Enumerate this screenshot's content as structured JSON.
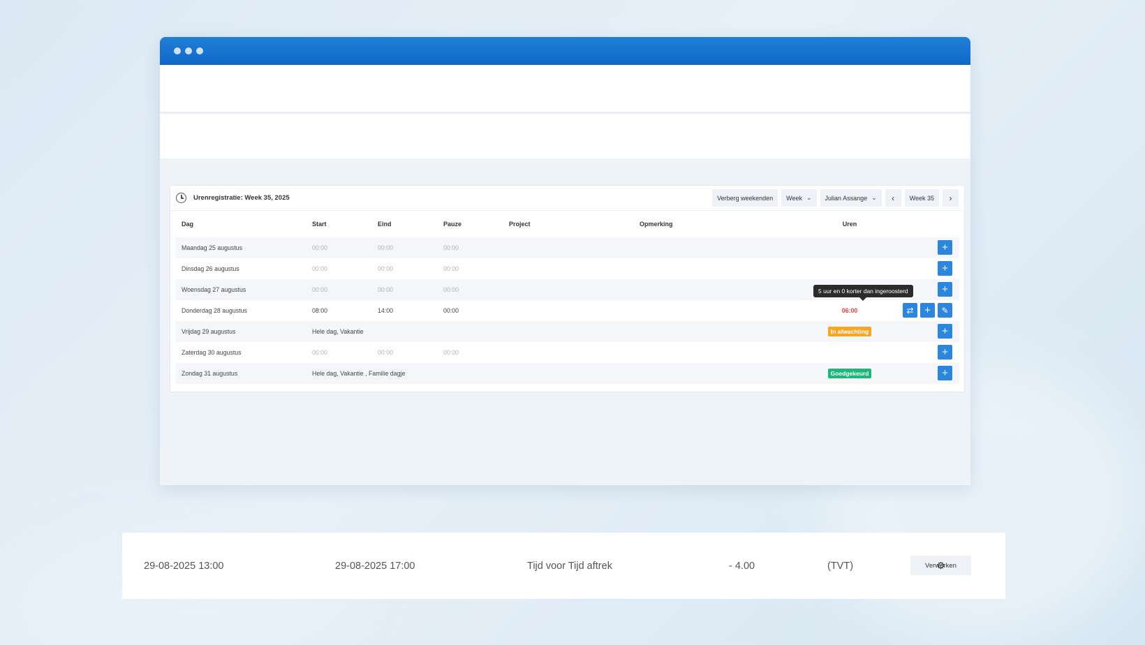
{
  "card": {
    "title": "Urenregistratie: Week 35, 2025",
    "toolbar": {
      "hide_weekends": "Verberg weekenden",
      "view": "Week",
      "user": "Julian Assange",
      "prev": "‹",
      "week": "Week 35",
      "next": "›"
    },
    "columns": {
      "dag": "Dag",
      "start": "Start",
      "eind": "Eind",
      "pauze": "Pauze",
      "project": "Project",
      "opmerking": "Opmerking",
      "uren": "Uren"
    },
    "rows": [
      {
        "dag": "Maandag 25 augustus",
        "start": "00:00",
        "eind": "00:00",
        "pauze": "00:00"
      },
      {
        "dag": "Dinsdag 26 augustus",
        "start": "00:00",
        "eind": "00:00",
        "pauze": "00:00"
      },
      {
        "dag": "Woensdag 27 augustus",
        "start": "00:00",
        "eind": "00:00",
        "pauze": "00:00"
      },
      {
        "dag": "Donderdag 28 augustus",
        "start": "08:00",
        "eind": "14:00",
        "pauze": "00:00",
        "uren": "06:00",
        "tooltip": "5 uur en 0 korter dan ingeroosterd"
      },
      {
        "dag": "Vrijdag 29 augustus",
        "note": "Hele dag, Vakantie",
        "status": "In afwachting"
      },
      {
        "dag": "Zaterdag 30 augustus",
        "start": "00:00",
        "eind": "00:00",
        "pauze": "00:00"
      },
      {
        "dag": "Zondag 31 augustus",
        "note": "Hele dag, Vakantie , Familie dagje",
        "status": "Goedgekeurd"
      }
    ],
    "status_colors": {
      "pending": "#f5a623",
      "approved": "#1eb67a",
      "short_hours": "#e0443e"
    }
  },
  "bottom": {
    "from": "29-08-2025 13:00",
    "to": "29-08-2025 17:00",
    "type": "Tijd voor Tijd aftrek",
    "amount": "- 4.00",
    "code": "(TVT)",
    "process_label": "Verwerken"
  },
  "accent_color": "#1f7fd8"
}
